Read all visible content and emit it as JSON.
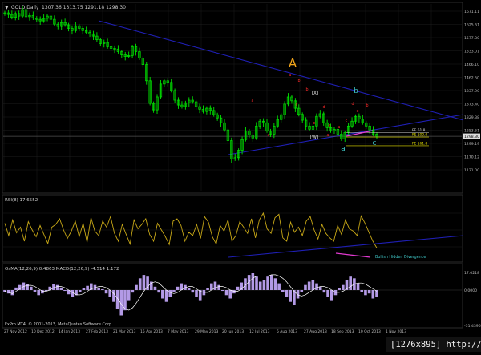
{
  "header": {
    "symbol_label": "GOLD,Daily",
    "ohlc": "1307.36  1313.75  1291.18  1298.30"
  },
  "colors": {
    "background": "#000000",
    "grid": "#1c1c1c",
    "axis_text": "#bdbdbd",
    "candle": "#00e600",
    "trendline": "#1f1fb4",
    "rsi": "#c8a817",
    "macd_hist": "#b39ae6",
    "signal": "#ffffff",
    "divergence": "#e23ad1",
    "label_orange": "#f1a41a",
    "label_cyan": "#3fc7c7",
    "label_red": "#ff2a2a",
    "fe_yellow": "#e7e200",
    "fe_white": "#d9d9d9",
    "watermark_bg": "#1a1a1a"
  },
  "chart_data": [
    {
      "type": "candlestick",
      "panel": "price",
      "symbol": "GOLD",
      "timeframe": "Daily",
      "ylim": [
        1130,
        1700
      ],
      "y_tick_labels": [
        "1671.11",
        "1625.61",
        "1577.30",
        "1533.01",
        "1466.10",
        "1462.50",
        "1337.90",
        "1373.40",
        "1329.38",
        "1253.61",
        "1299.19",
        "1170.12",
        "1121.00"
      ],
      "current_price": "1298.30",
      "close_trace": [
        1680,
        1675,
        1666,
        1678,
        1670,
        1690,
        1668,
        1672,
        1664,
        1660,
        1655,
        1663,
        1670,
        1660,
        1645,
        1638,
        1650,
        1643,
        1632,
        1625,
        1640,
        1632,
        1625,
        1620,
        1615,
        1608,
        1597,
        1585,
        1588,
        1575,
        1570,
        1568,
        1560,
        1550,
        1545,
        1548,
        1575,
        1560,
        1540,
        1520,
        1470,
        1400,
        1380,
        1420,
        1460,
        1470,
        1465,
        1440,
        1410,
        1395,
        1390,
        1402,
        1410,
        1405,
        1390,
        1382,
        1375,
        1385,
        1378,
        1365,
        1355,
        1340,
        1318,
        1285,
        1228,
        1232,
        1255,
        1288,
        1315,
        1302,
        1293,
        1330,
        1345,
        1340,
        1315,
        1305,
        1330,
        1350,
        1365,
        1398,
        1420,
        1408,
        1385,
        1366,
        1348,
        1330,
        1320,
        1330,
        1360,
        1368,
        1340,
        1325,
        1315,
        1320,
        1305,
        1290,
        1310,
        1330,
        1345,
        1360,
        1352,
        1340,
        1330,
        1318,
        1305,
        1298
      ],
      "annotations": [
        "A",
        "b",
        "a",
        "c",
        "[X]",
        "[W]",
        "a",
        "b",
        "c",
        "d",
        "e"
      ],
      "fib_levels": [
        {
          "label": "FE 61.8",
          "value": 1310
        },
        {
          "label": "FE 100.0",
          "value": 1296
        },
        {
          "label": "FE 161.8",
          "value": 1269
        }
      ]
    },
    {
      "type": "line",
      "panel": "rsi",
      "title": "RSI(8) 17.6552",
      "ylim": [
        0,
        100
      ],
      "values": [
        62,
        40,
        68,
        45,
        55,
        30,
        65,
        50,
        38,
        58,
        42,
        26,
        55,
        60,
        70,
        50,
        35,
        48,
        66,
        38,
        62,
        28,
        72,
        48,
        40,
        66,
        55,
        74,
        44,
        30,
        60,
        42,
        25,
        68,
        52,
        60,
        70,
        42,
        30,
        62,
        50,
        38,
        24,
        66,
        70,
        58,
        30,
        46,
        40,
        60,
        35,
        74,
        64,
        38,
        25,
        58,
        48,
        68,
        30,
        40,
        65,
        55,
        44,
        70,
        36,
        68,
        80,
        52,
        44,
        72,
        78,
        36,
        30,
        64,
        46,
        55,
        40,
        66,
        74,
        50,
        34,
        60,
        44,
        36,
        30,
        58,
        42,
        68,
        52,
        48,
        40,
        75,
        62,
        46,
        30,
        18
      ],
      "annotation": "Bullish Hidden Divergence"
    },
    {
      "type": "bar",
      "panel": "macd",
      "title": "OsMA(12,26,9)  0.4863  MACD(12,26,9)  -4.514  1.172",
      "y_tick_labels": [
        "17.0218",
        "0.0000",
        "-31.4396"
      ],
      "osma": [
        -2,
        -4,
        -6,
        3,
        6,
        9,
        7,
        4,
        -2,
        -6,
        -4,
        -1,
        4,
        7,
        6,
        3,
        -1,
        -5,
        -8,
        -6,
        -2,
        2,
        5,
        8,
        6,
        3,
        1,
        -4,
        -8,
        -14,
        -22,
        -30,
        -24,
        -12,
        -3,
        6,
        14,
        18,
        16,
        10,
        4,
        -3,
        -10,
        -14,
        -8,
        -2,
        4,
        8,
        6,
        2,
        -3,
        -8,
        -12,
        -6,
        2,
        8,
        10,
        6,
        -1,
        -6,
        -10,
        -4,
        4,
        9,
        14,
        18,
        20,
        16,
        10,
        12,
        16,
        18,
        14,
        8,
        -2,
        -8,
        -14,
        -18,
        -10,
        -2,
        6,
        10,
        12,
        8,
        4,
        -3,
        -8,
        -12,
        -6,
        2,
        6,
        12,
        16,
        14,
        8,
        -2,
        -6,
        -4,
        -10,
        -8
      ],
      "signal": [
        -1,
        -2,
        -3,
        -1,
        1,
        3,
        4,
        4,
        3,
        1,
        -1,
        -1,
        0,
        2,
        3,
        3,
        2,
        0,
        -2,
        -4,
        -4,
        -3,
        -1,
        1,
        2,
        3,
        3,
        2,
        0,
        -3,
        -7,
        -12,
        -16,
        -17,
        -15,
        -11,
        -6,
        -1,
        3,
        6,
        7,
        6,
        3,
        0,
        -2,
        -3,
        -2,
        0,
        2,
        3,
        3,
        1,
        -1,
        -2,
        -2,
        0,
        2,
        3,
        3,
        2,
        0,
        -1,
        -1,
        1,
        4,
        7,
        10,
        12,
        12,
        12,
        12,
        13,
        13,
        12,
        10,
        7,
        3,
        -1,
        -4,
        -5,
        -4,
        -2,
        0,
        2,
        3,
        3,
        2,
        0,
        -2,
        -2,
        -1,
        1,
        3,
        5,
        6,
        6,
        5,
        3,
        1,
        -1
      ],
      "baseline": 0
    }
  ],
  "x_axis_labels": [
    "27 Nov 2012",
    "10 Dec 2012",
    "14 Jan 2013",
    "27 Feb 2013",
    "21 Mar 2013",
    "15 Apr 2013",
    "7 May 2013",
    "29 May 2013",
    "20 Jun 2013",
    "12 Jul 2013",
    "5 Aug 2013",
    "27 Aug 2013",
    "18 Sep 2013",
    "10 Oct 2013",
    "1 Nov 2013"
  ],
  "footer_text": "FxPro MT4, © 2001-2013, MetaQuotes Software Corp.",
  "watermark": "[1276x895]  http://upic.me/"
}
